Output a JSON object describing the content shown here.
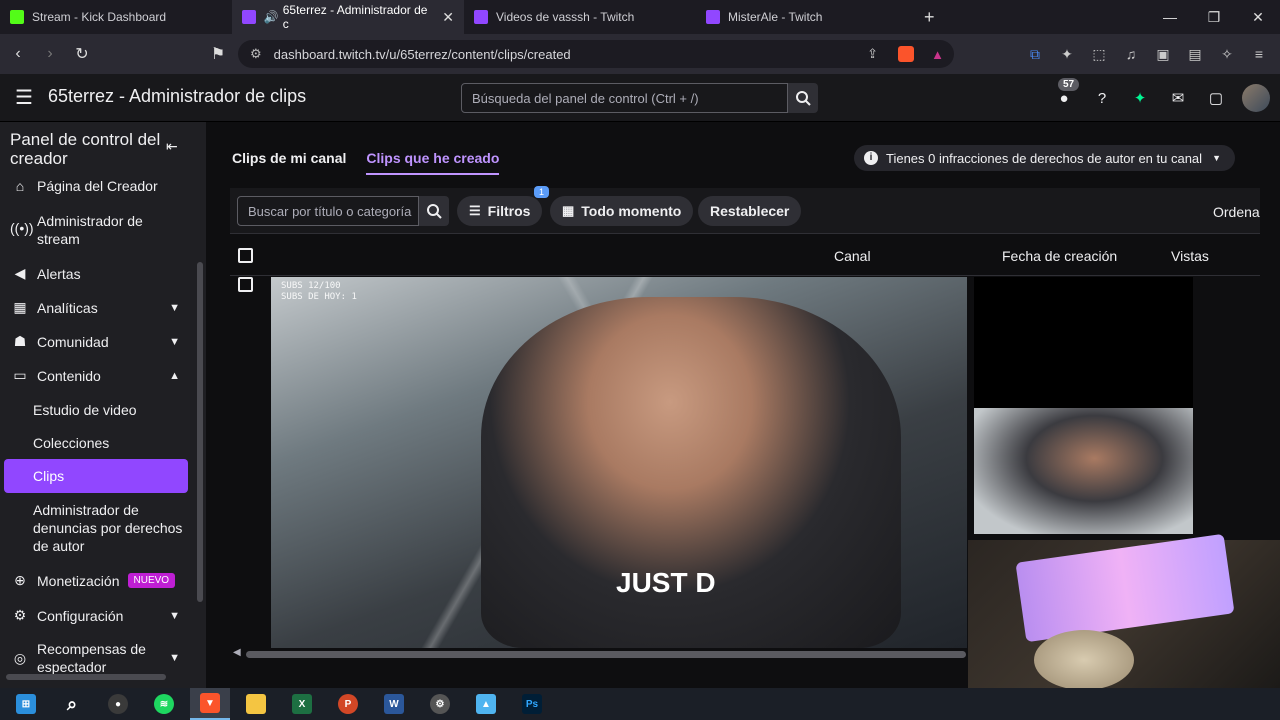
{
  "browser": {
    "tabs": [
      {
        "label": "Stream - Kick Dashboard",
        "color": "#53fc18"
      },
      {
        "label": "65terrez - Administrador de c",
        "color": "#9147ff"
      },
      {
        "label": "Videos de vasssh - Twitch",
        "color": "#9147ff"
      },
      {
        "label": "MisterAle - Twitch",
        "color": "#9147ff"
      }
    ],
    "url": "dashboard.twitch.tv/u/65terrez/content/clips/created"
  },
  "header": {
    "title": "65terrez - Administrador de clips",
    "search_placeholder": "Búsqueda del panel de control (Ctrl + /)",
    "notifications_count": "57"
  },
  "sidebar": {
    "heading": "Panel de control del creador",
    "items": [
      {
        "label": "Página del Creador",
        "icon": "home-icon"
      },
      {
        "label": "Administrador de stream",
        "icon": "broadcast-icon"
      },
      {
        "label": "Alertas",
        "icon": "megaphone-icon"
      },
      {
        "label": "Analíticas",
        "icon": "chart-icon"
      },
      {
        "label": "Comunidad",
        "icon": "community-icon"
      },
      {
        "label": "Contenido",
        "icon": "content-icon"
      }
    ],
    "content_sub": [
      "Estudio de video",
      "Colecciones",
      "Clips",
      "Administrador de denuncias por derechos de autor"
    ],
    "monetization": "Monetización",
    "new_badge": "NUEVO",
    "settings": "Configuración",
    "rewards": "Recompensas de espectador"
  },
  "main": {
    "tabs": [
      "Clips de mi canal",
      "Clips que he creado"
    ],
    "copyright_notice": "Tienes 0 infracciones de derechos de autor en tu canal",
    "filter_placeholder": "Buscar por título o categoría",
    "filters_label": "Filtros",
    "filters_count": "1",
    "time_label": "Todo momento",
    "reset_label": "Restablecer",
    "sort_label": "Ordena",
    "columns": [
      "Canal",
      "Fecha de creación",
      "Vistas"
    ],
    "video_caption": "SUBS 12/100\nSUBS DE HOY: 1",
    "shirt_text": "JUST D"
  },
  "taskbar": {
    "apps": [
      "start",
      "search",
      "obs",
      "spotify",
      "brave",
      "explorer",
      "excel",
      "powerpoint",
      "word",
      "settings",
      "capcut",
      "photoshop"
    ]
  }
}
